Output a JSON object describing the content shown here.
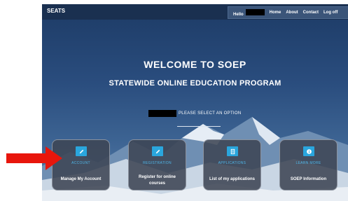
{
  "brand": "SEATS",
  "nav": {
    "greeting": "Hello",
    "items": [
      "Home",
      "About",
      "Contact",
      "Log off"
    ]
  },
  "welcome": "WELCOME TO SOEP",
  "program": "STATEWIDE ONLINE EDUCATION PROGRAM",
  "select_prompt": "PLEASE SELECT AN OPTION",
  "cards": [
    {
      "label": "ACCOUNT",
      "description": "Manage My Account",
      "icon": "pencil-icon"
    },
    {
      "label": "REGISTRATION",
      "description": "Register for online courses",
      "icon": "pencil-icon"
    },
    {
      "label": "APPLICATIONS",
      "description": "List of my applications",
      "icon": "document-icon"
    },
    {
      "label": "LEARN MORE",
      "description": "SOEP Information",
      "icon": "info-icon"
    }
  ],
  "colors": {
    "accent": "#2aa6dd",
    "annotation_arrow": "#e8160c"
  }
}
